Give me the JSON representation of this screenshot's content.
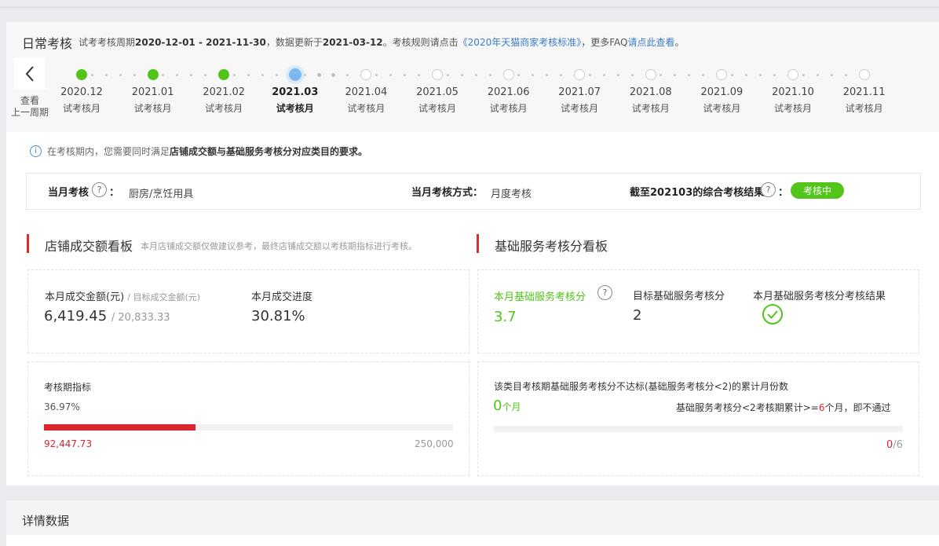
{
  "header": {
    "title": "日常考核",
    "desc_prefix": "试考考核周期",
    "period": "2020-12-01 - 2021-11-30",
    "desc_mid": "，数据更新于",
    "update_date": "2021-03-12",
    "desc_rule": "。考核规则请点击",
    "rule_link": "《2020年天猫商家考核标准》",
    "desc_faq": "，更多FAQ",
    "faq_link": "请点此查看",
    "desc_end": "。"
  },
  "timeline": {
    "back_label_1": "查看",
    "back_label_2": "上一周期",
    "months": [
      {
        "month": "2020.12",
        "sub": "试考核月",
        "state": "done"
      },
      {
        "month": "2021.01",
        "sub": "试考核月",
        "state": "done"
      },
      {
        "month": "2021.02",
        "sub": "试考核月",
        "state": "done"
      },
      {
        "month": "2021.03",
        "sub": "试考核月",
        "state": "current"
      },
      {
        "month": "2021.04",
        "sub": "试考核月",
        "state": "pending"
      },
      {
        "month": "2021.05",
        "sub": "试考核月",
        "state": "pending"
      },
      {
        "month": "2021.06",
        "sub": "试考核月",
        "state": "pending"
      },
      {
        "month": "2021.07",
        "sub": "试考核月",
        "state": "pending"
      },
      {
        "month": "2021.08",
        "sub": "试考核月",
        "state": "pending"
      },
      {
        "month": "2021.09",
        "sub": "试考核月",
        "state": "pending"
      },
      {
        "month": "2021.10",
        "sub": "试考核月",
        "state": "pending"
      },
      {
        "month": "2021.11",
        "sub": "试考核月",
        "state": "pending"
      }
    ]
  },
  "notice": {
    "text_prefix": "在考核期内，您需要同时满足",
    "text_bold": "店铺成交额与基础服务考核分对应类目的要求。"
  },
  "assessment": {
    "month_label": "当月考核",
    "colon": "：",
    "category": "厨房/烹饪用具",
    "method_label": "当月考核方式：",
    "method_value": "月度考核",
    "result_label": "截至202103的综合考核结果",
    "status": "考核中"
  },
  "sales_board": {
    "title": "店铺成交额看板",
    "subtitle": "本月店铺成交额仅做建议参考，最终店铺成交额以考核期指标进行考核。",
    "amount_label": "本月成交金额(元)",
    "target_label": "/ 目标成交金额(元)",
    "amount_value": "6,419.45",
    "target_value": "/ 20,833.33",
    "progress_label": "本月成交进度",
    "progress_value": "30.81%",
    "period_label": "考核期指标",
    "period_percent": "36.97%",
    "period_fraction": 0.3697,
    "period_current": "92,447.73",
    "period_target": "250,000"
  },
  "service_board": {
    "title": "基础服务考核分看板",
    "score_label": "本月基础服务考核分",
    "score_value": "3.7",
    "target_label": "目标基础服务考核分",
    "target_value": "2",
    "result_label": "本月基础服务考核分考核结果",
    "fail_desc": "该类目考核期基础服务考核分不达标(基础服务考核分<2)的累计月份数",
    "fail_count": "0",
    "fail_unit": "个月",
    "rule_prefix": "基础服务考核分<2考核期累计>=",
    "rule_num": "6",
    "rule_suffix": "个月，即不通过",
    "fail_current": "0",
    "fail_total": "/6",
    "fail_fraction": 0
  },
  "detail": {
    "title": "详情数据"
  },
  "colors": {
    "green": "#52c41a",
    "red": "#d7262f",
    "blue": "#3a7cc9",
    "current_dot": "#7db9f0"
  }
}
